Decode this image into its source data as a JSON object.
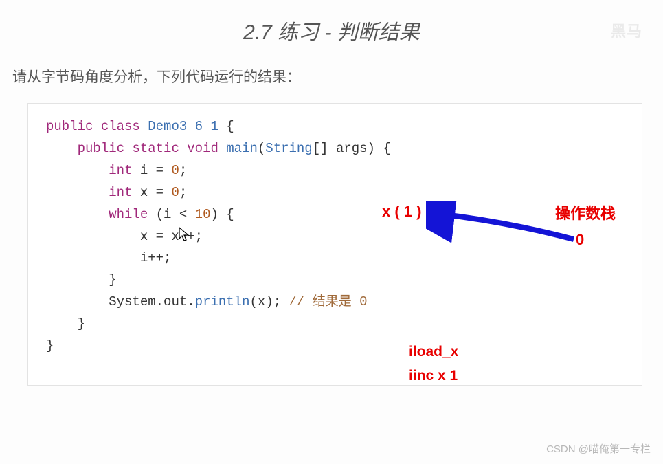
{
  "title": "2.7 练习 - 判断结果",
  "prompt": "请从字节码角度分析，下列代码运行的结果：",
  "code": {
    "keyword_public": "public",
    "keyword_class": "class",
    "class_name": "Demo3_6_1",
    "keyword_static": "static",
    "keyword_void": "void",
    "fn_main": "main",
    "type_string_arr": "String",
    "param_args": "args",
    "type_int": "int",
    "var_i": "i",
    "var_x": "x",
    "lit_zero": "0",
    "keyword_while": "while",
    "lit_ten": "10",
    "assign_line": "x = x++;",
    "inc_line": "i++;",
    "println_prefix": "System.",
    "println_out": "out",
    "println_method": "println",
    "println_arg": "x",
    "comment_result": "// 结果是 0"
  },
  "annotations": {
    "x1": "x ( 1 )",
    "opstack": "操作数栈",
    "zero": "0",
    "iload": "iload_x",
    "iinc": "iinc x 1"
  },
  "watermark": "CSDN @喵俺第一专栏",
  "corner_mark": "黑马"
}
